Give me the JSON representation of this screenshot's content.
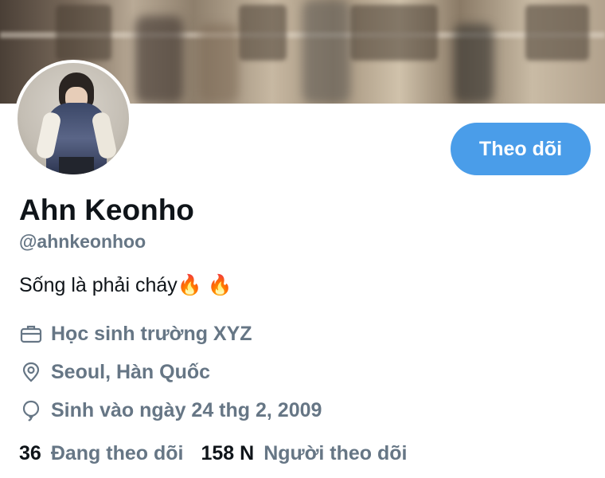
{
  "profile": {
    "name": "Ahn Keonho",
    "handle": "@ahnkeonhoo",
    "bio": "Sống là phải cháy🔥 🔥",
    "job": "Học sinh trường XYZ",
    "location": "Seoul, Hàn Quốc",
    "birthday": "Sinh vào ngày 24 thg 2, 2009"
  },
  "follow_button": {
    "label": "Theo dõi"
  },
  "stats": {
    "following_count": "36",
    "following_label": "Đang theo dõi",
    "followers_count": "158 N",
    "followers_label": "Người theo dõi"
  },
  "icons": {
    "job": "briefcase-icon",
    "location": "location-pin-icon",
    "birthday": "balloon-icon"
  },
  "colors": {
    "accent": "#4a9de9",
    "text_primary": "#0f1419",
    "text_secondary": "#667685",
    "background": "#ffffff"
  }
}
